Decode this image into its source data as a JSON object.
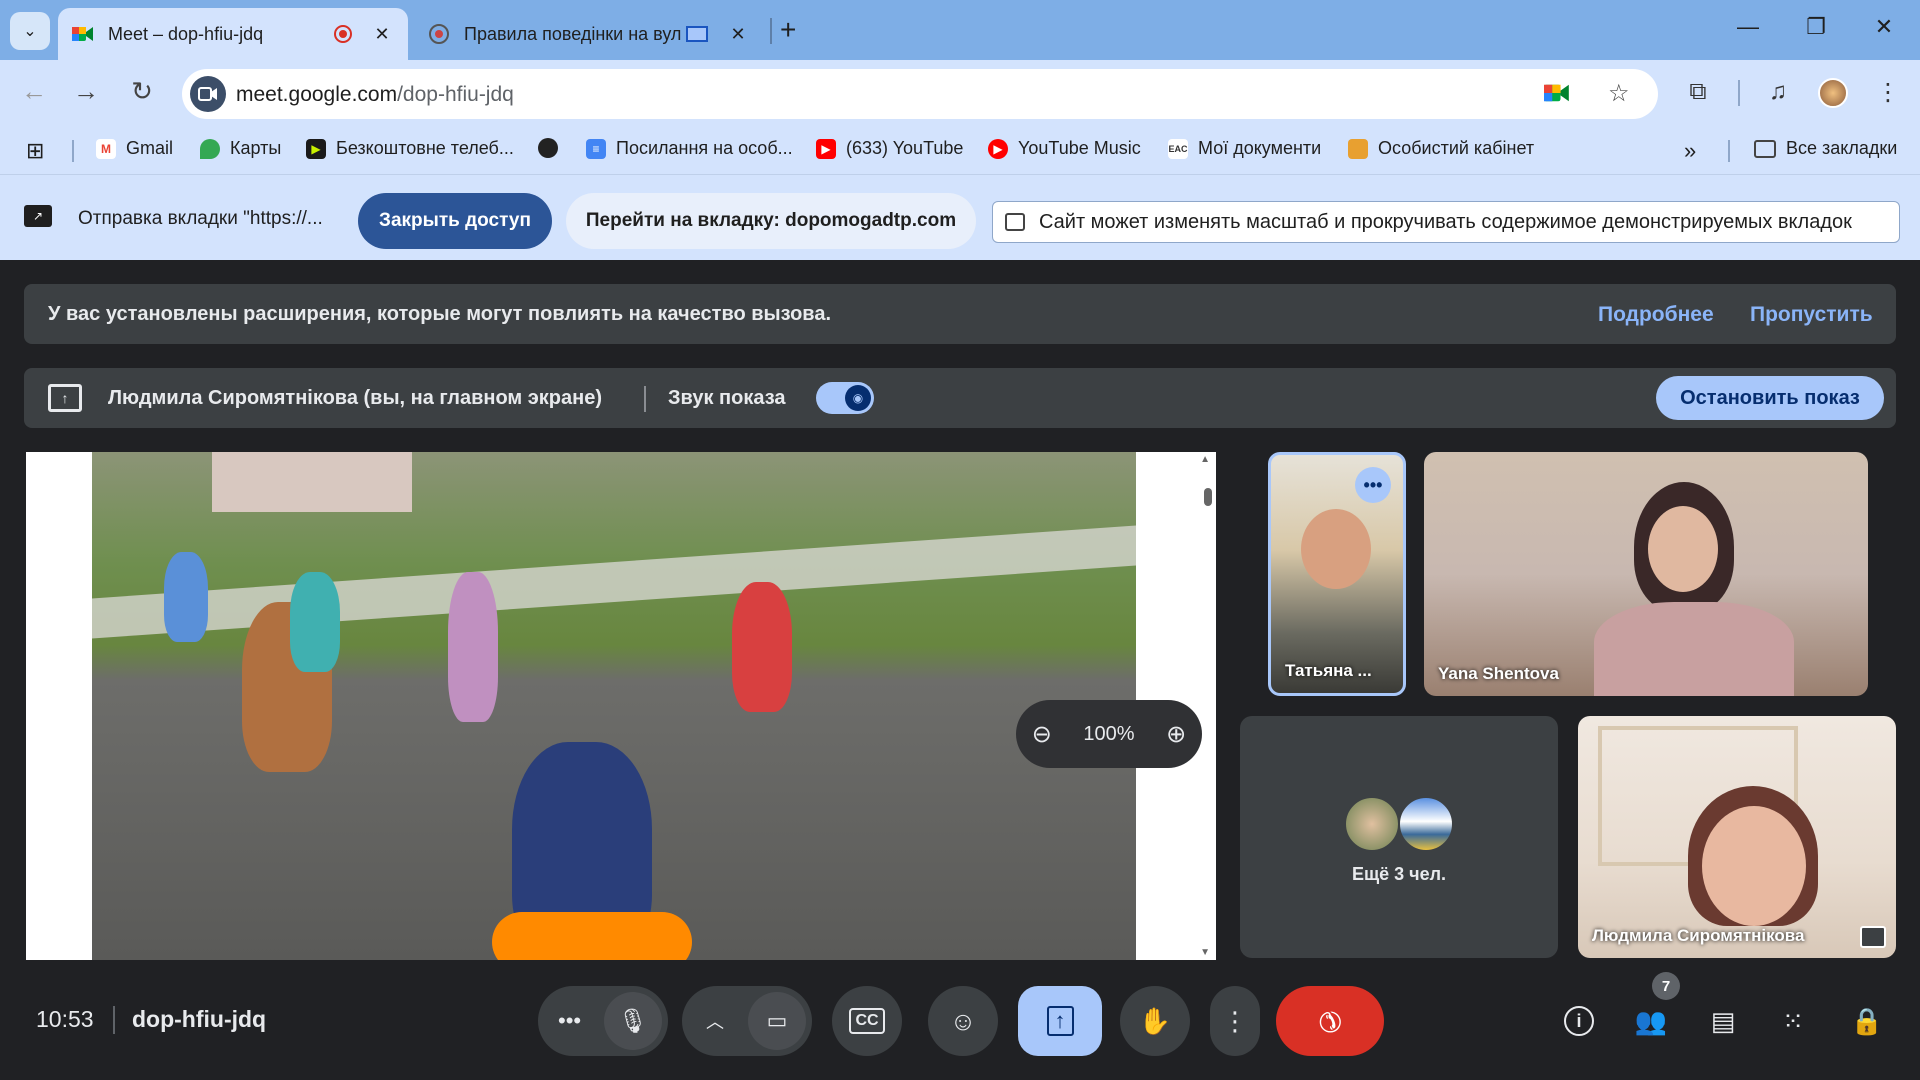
{
  "browser": {
    "tabs": [
      {
        "title": "Meet – dop-hfiu-jdq",
        "active": true
      },
      {
        "title": "Правила поведінки на вул",
        "active": false
      }
    ],
    "address": {
      "host": "meet.google.com",
      "path": "/dop-hfiu-jdq"
    },
    "bookmarks": [
      {
        "label": "Gmail",
        "icon": "gmail-icon"
      },
      {
        "label": "Карты",
        "icon": "maps-icon"
      },
      {
        "label": "Безкоштовне телеб...",
        "icon": "tv-icon"
      },
      {
        "label": "",
        "icon": "globe-icon"
      },
      {
        "label": "Посилання на особ...",
        "icon": "docs-icon"
      },
      {
        "label": "(633) YouTube",
        "icon": "youtube-icon"
      },
      {
        "label": "YouTube Music",
        "icon": "youtube-music-icon"
      },
      {
        "label": "Мої документи",
        "icon": "documents-icon"
      },
      {
        "label": "Особистий кабінет",
        "icon": "cabinet-icon"
      }
    ],
    "all_bookmarks": "Все закладки"
  },
  "share_bar": {
    "text": "Отправка вкладки \"https://...",
    "stop_access": "Закрыть доступ",
    "goto_tab": "Перейти на вкладку: dopomogadtp.com",
    "note": "Сайт может изменять масштаб и прокручивать содержимое демонстрируемых вкладок"
  },
  "meet": {
    "ext_banner": {
      "message": "У вас установлены расширения, которые могут повлиять на качество вызова.",
      "more": "Подробнее",
      "skip": "Пропустить"
    },
    "presenting": {
      "label": "Людмила Сиромятнікова (вы, на главном экране)",
      "audio_label": "Звук показа",
      "stop": "Остановить показ"
    },
    "zoom": "100%",
    "participants": [
      {
        "name": "Татьяна ..."
      },
      {
        "name": "Yana Shentova"
      },
      {
        "name": "Людмила Сиромятнікова"
      }
    ],
    "others": "Ещё 3 чел.",
    "time": "10:53",
    "code": "dop-hfiu-jdq",
    "people_count": "7"
  }
}
